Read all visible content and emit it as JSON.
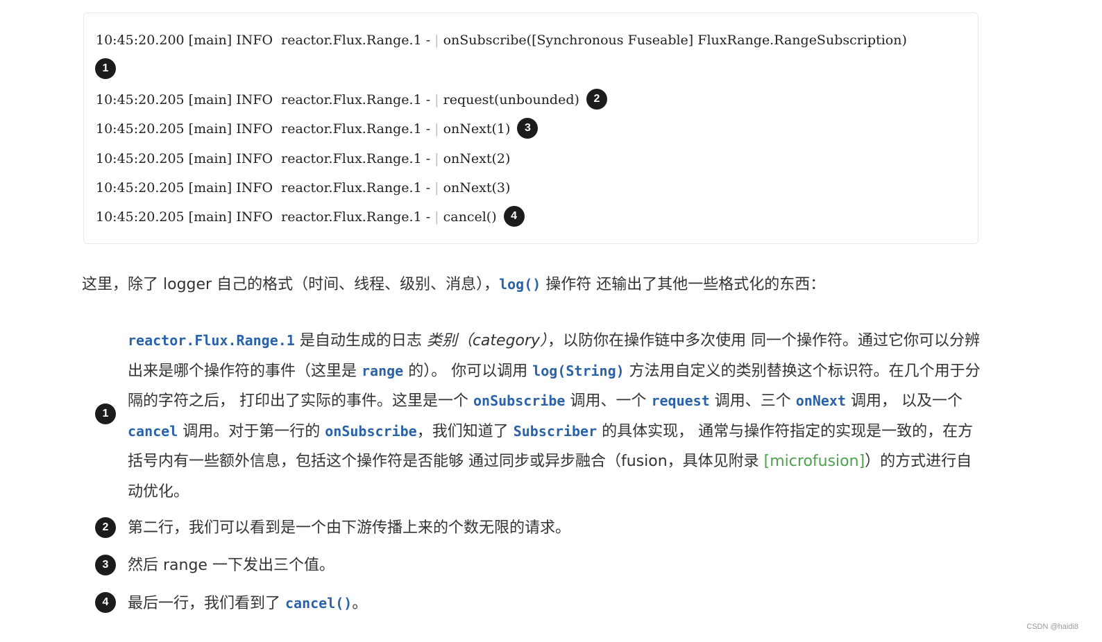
{
  "log": {
    "prefix": "10:45:20.200 [main] INFO  reactor.Flux.Range.1 - ",
    "sep": "|",
    "lines": [
      {
        "prefix": "10:45:20.200 [main] INFO  reactor.Flux.Range.1 - ",
        "msg": " onSubscribe([Synchronous Fuseable] FluxRange.RangeSubscription)"
      },
      {
        "prefix": "10:45:20.205 [main] INFO  reactor.Flux.Range.1 - ",
        "msg": " request(unbounded)",
        "badge": "2"
      },
      {
        "prefix": "10:45:20.205 [main] INFO  reactor.Flux.Range.1 - ",
        "msg": " onNext(1)",
        "badge": "3"
      },
      {
        "prefix": "10:45:20.205 [main] INFO  reactor.Flux.Range.1 - ",
        "msg": " onNext(2)"
      },
      {
        "prefix": "10:45:20.205 [main] INFO  reactor.Flux.Range.1 - ",
        "msg": " onNext(3)"
      },
      {
        "prefix": "10:45:20.205 [main] INFO  reactor.Flux.Range.1 - ",
        "msg": " cancel()",
        "badge": "4"
      }
    ],
    "badge1": "1"
  },
  "intro": {
    "t1": "这里，除了 logger 自己的格式（时间、线程、级别、消息），",
    "code": "log()",
    "t2": " 操作符 还输出了其他一些格式化的东西："
  },
  "explanations": {
    "one": {
      "badge": "1",
      "c1": "reactor.Flux.Range.1",
      "t1": " 是自动生成的日志 ",
      "em": "类别（category）",
      "t2": "，以防你在操作链中多次使用 同一个操作符。通过它你可以分辨出来是哪个操作符的事件（这里是 ",
      "c2": "range",
      "t3": " 的）。 你可以调用 ",
      "c3": "log(String)",
      "t4": " 方法用自定义的类别替换这个标识符。在几个用于分隔的字符之后， 打印出了实际的事件。这里是一个 ",
      "c4": "onSubscribe",
      "t5": " 调用、一个 ",
      "c5": "request",
      "t6": " 调用、三个 ",
      "c6": "onNext",
      "t7": " 调用， 以及一个 ",
      "c7": "cancel",
      "t8": " 调用。对于第一行的 ",
      "c8": "onSubscribe",
      "t9": "，我们知道了 ",
      "c9": "Subscriber",
      "t10": " 的具体实现， 通常与操作符指定的实现是一致的，在方括号内有一些额外信息，包括这个操作符是否能够 通过同步或异步融合（fusion，具体见附录 ",
      "link": "[microfusion]",
      "t11": "）的方式进行自动优化。"
    },
    "two": {
      "badge": "2",
      "text": "第二行，我们可以看到是一个由下游传播上来的个数无限的请求。"
    },
    "three": {
      "badge": "3",
      "text": "然后 range 一下发出三个值。"
    },
    "four": {
      "badge": "4",
      "t1": "最后一行，我们看到了 ",
      "code": "cancel()",
      "t2": "。"
    }
  },
  "watermark": "CSDN @haidi8",
  "colors": {
    "code": "#2962a8",
    "link": "#4ea14e",
    "badge": "#1c1c1c",
    "border": "#e8e8ee"
  }
}
